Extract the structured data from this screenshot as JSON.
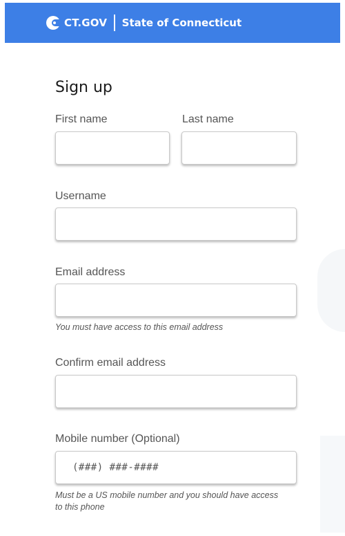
{
  "header": {
    "brand": "CT.GOV",
    "state_name": "State of Connecticut"
  },
  "form": {
    "title": "Sign up",
    "first_name": {
      "label": "First name",
      "value": ""
    },
    "last_name": {
      "label": "Last name",
      "value": ""
    },
    "username": {
      "label": "Username",
      "value": ""
    },
    "email": {
      "label": "Email address",
      "value": "",
      "hint": "You must have access to this email address"
    },
    "confirm_email": {
      "label": "Confirm email address",
      "value": ""
    },
    "mobile": {
      "label": "Mobile number (Optional)",
      "value": "",
      "placeholder": "(###) ###-####",
      "hint": "Must be a US mobile number and you should have access to this phone"
    }
  },
  "colors": {
    "header_bg": "#3d7fe6"
  }
}
